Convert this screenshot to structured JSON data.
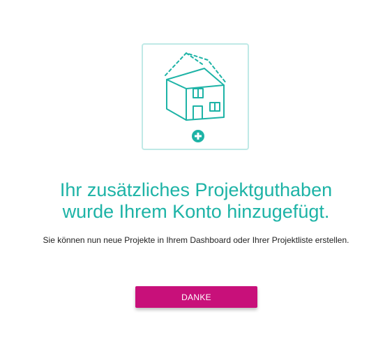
{
  "illustration": {
    "house_icon": "house-with-dashed-roof-icon",
    "add_icon": "plus-circle-icon"
  },
  "headline": {
    "line1": "Ihr zusätzliches Projektguthaben",
    "line2": "wurde Ihrem Konto hinzugefügt."
  },
  "message": "Sie können nun neue Projekte in Ihrem Dashboard oder Ihrer Projektliste erstellen.",
  "confirm_button": {
    "label": "DANKE"
  },
  "colors": {
    "accent": "#1db3a6",
    "card_border": "#bfe9e6",
    "button": "#c8107a"
  }
}
